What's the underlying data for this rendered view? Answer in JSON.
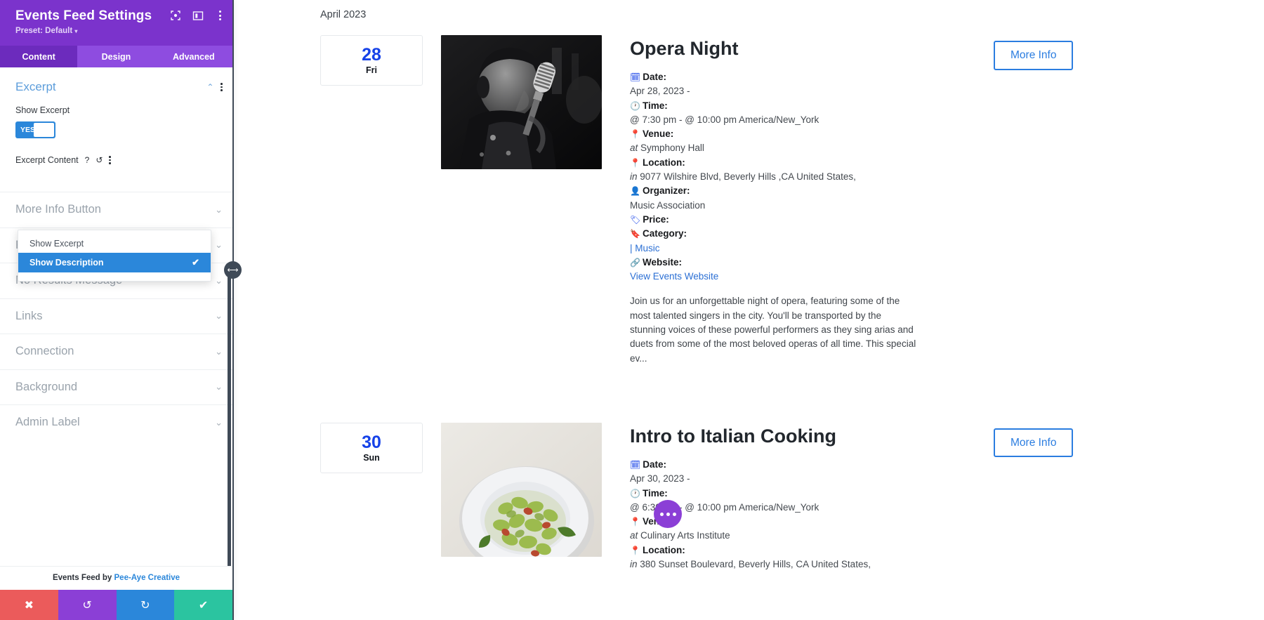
{
  "sidebar": {
    "title": "Events Feed Settings",
    "preset": "Preset: Default",
    "preset_caret": "▾",
    "tabs": [
      {
        "label": "Content",
        "active": true
      },
      {
        "label": "Design",
        "active": false
      },
      {
        "label": "Advanced",
        "active": false
      }
    ],
    "section": {
      "title": "Excerpt",
      "show_excerpt_label": "Show Excerpt",
      "toggle_value": "YES",
      "excerpt_content_label": "Excerpt Content",
      "help_icon": "?",
      "reset_icon": "↺"
    },
    "dropdown": {
      "options": [
        {
          "label": "Show Excerpt",
          "selected": false
        },
        {
          "label": "Show Description",
          "selected": true
        }
      ],
      "check_glyph": "✔"
    },
    "accordion": [
      {
        "label": "More Info Button"
      },
      {
        "label": "Pagination"
      },
      {
        "label": "No Results Message"
      },
      {
        "label": "Links"
      },
      {
        "label": "Connection"
      },
      {
        "label": "Background"
      },
      {
        "label": "Admin Label"
      }
    ],
    "chevron_down": "⌄",
    "chevron_up": "⌃",
    "footer": {
      "credit_prefix": "Events Feed by ",
      "credit_link": "Pee-Aye Creative"
    },
    "actions": [
      {
        "name": "cancel",
        "glyph": "✖"
      },
      {
        "name": "undo",
        "glyph": "↺"
      },
      {
        "name": "redo",
        "glyph": "↻"
      },
      {
        "name": "save",
        "glyph": "✔"
      }
    ]
  },
  "main": {
    "month_label": "April 2023",
    "more_info_label": "More Info",
    "fab_label": "•••",
    "events": [
      {
        "day": "28",
        "dow": "Fri",
        "title": "Opera Night",
        "image_alt": "singer-with-microphone-photo",
        "meta": [
          {
            "icon": "calendar-icon",
            "key": "Date:",
            "value": "Apr 28, 2023 -",
            "italic_prefix": ""
          },
          {
            "icon": "clock-icon",
            "key": "Time:",
            "value": "@ 7:30 pm - @ 10:00 pm America/New_York",
            "italic_prefix": ""
          },
          {
            "icon": "pin-icon",
            "key": "Venue:",
            "value": "Symphony Hall",
            "italic_prefix": "at"
          },
          {
            "icon": "pin-icon",
            "key": "Location:",
            "value": "9077 Wilshire Blvd, Beverly Hills ,CA United States,",
            "italic_prefix": "in"
          },
          {
            "icon": "person-icon",
            "key": "Organizer:",
            "value": "Music Association",
            "italic_prefix": ""
          },
          {
            "icon": "tag-icon",
            "key": "Price:",
            "value": "",
            "italic_prefix": ""
          },
          {
            "icon": "bookmark-icon",
            "key": "Category:",
            "value": "| Music",
            "italic_prefix": "",
            "link": true
          },
          {
            "icon": "link-icon",
            "key": "Website:",
            "value": "View Events Website",
            "italic_prefix": "",
            "link": true
          }
        ],
        "description": "Join us for an unforgettable night of opera, featuring some of the most talented singers in the city. You'll be transported by the stunning voices of these powerful performers as they sing arias and duets from some of the most beloved operas of all time. This special ev..."
      },
      {
        "day": "30",
        "dow": "Sun",
        "title": "Intro to Italian Cooking",
        "image_alt": "pasta-plate-photo",
        "meta": [
          {
            "icon": "calendar-icon",
            "key": "Date:",
            "value": "Apr 30, 2023 -",
            "italic_prefix": ""
          },
          {
            "icon": "clock-icon",
            "key": "Time:",
            "value": "@ 6:30 pm - @ 10:00 pm America/New_York",
            "italic_prefix": ""
          },
          {
            "icon": "pin-icon",
            "key": "Venue:",
            "value": "Culinary Arts Institute",
            "italic_prefix": "at"
          },
          {
            "icon": "pin-icon",
            "key": "Location:",
            "value": "380 Sunset Boulevard, Beverly Hills, CA United States,",
            "italic_prefix": "in"
          }
        ],
        "description": ""
      }
    ]
  },
  "colors": {
    "purple": "#7b33cc",
    "tab_purple": "#8e4ce0",
    "blue": "#2b87da",
    "link_blue": "#2b6fd4",
    "date_blue": "#1642e8",
    "red": "#eb5b5b",
    "green": "#2bc4a0"
  }
}
